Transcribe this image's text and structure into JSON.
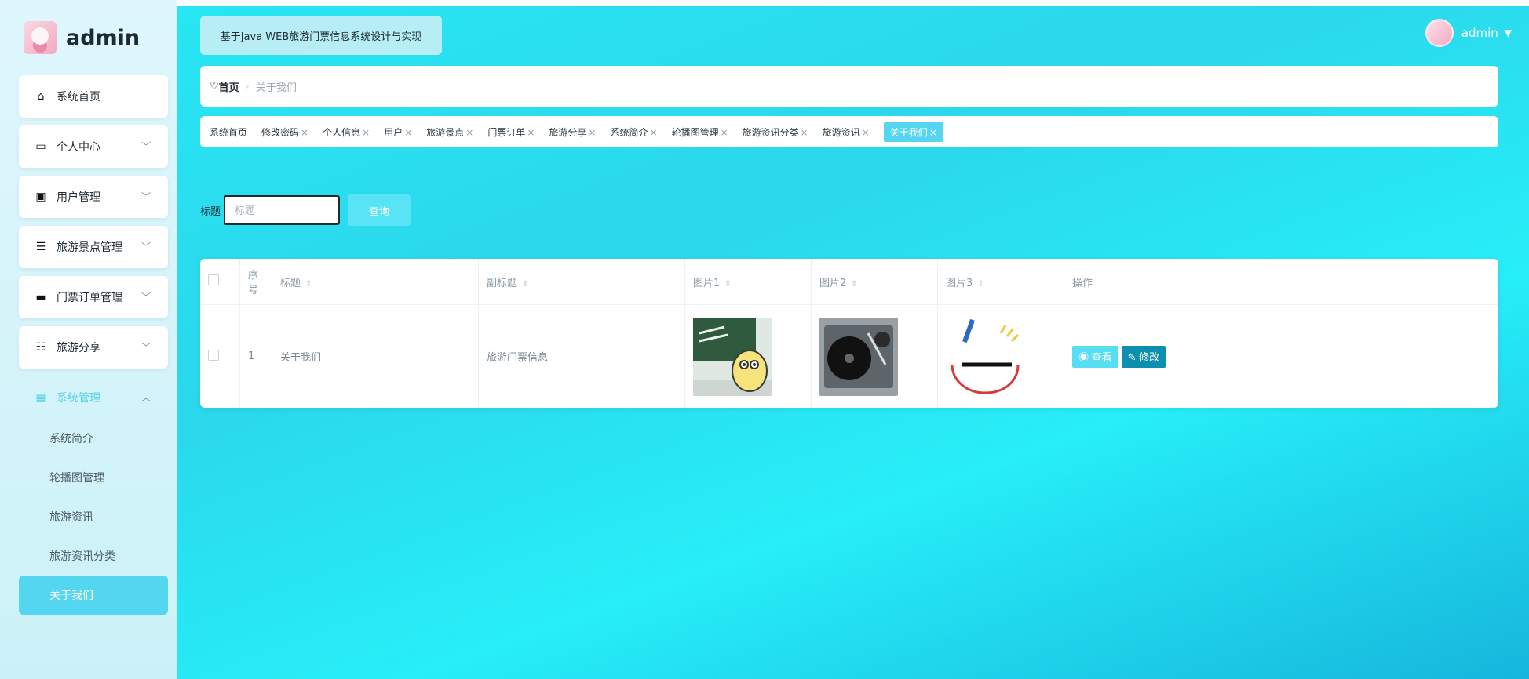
{
  "sidebar": {
    "brand": "admin",
    "items": [
      {
        "label": "系统首页",
        "icon": "home-icon",
        "chev": "",
        "active": false
      },
      {
        "label": "个人中心",
        "icon": "wallet-icon",
        "chev": "﹀",
        "active": false
      },
      {
        "label": "用户管理",
        "icon": "user-icon",
        "chev": "﹀",
        "active": false
      },
      {
        "label": "旅游景点管理",
        "icon": "list-icon",
        "chev": "﹀",
        "active": false
      },
      {
        "label": "门票订单管理",
        "icon": "chat-icon",
        "chev": "﹀",
        "active": false
      },
      {
        "label": "旅游分享",
        "icon": "sliders-icon",
        "chev": "﹀",
        "active": false
      },
      {
        "label": "系统管理",
        "icon": "grid-icon",
        "chev": "︿",
        "active": true
      }
    ],
    "subitems": [
      "系统简介",
      "轮播图管理",
      "旅游资讯",
      "旅游资讯分类",
      "关于我们"
    ]
  },
  "header": {
    "app_title": "基于Java WEB旅游门票信息系统设计与实现",
    "user": "admin"
  },
  "breadcrumb": {
    "home": "首页",
    "sep": "›",
    "current": "关于我们"
  },
  "tabs": [
    "系统首页",
    "修改密码",
    "个人信息",
    "用户",
    "旅游景点",
    "门票订单",
    "旅游分享",
    "系统简介",
    "轮播图管理",
    "旅游资讯分类",
    "旅游资讯",
    "关于我们"
  ],
  "search": {
    "label": "标题",
    "placeholder": "标题",
    "button": "查询"
  },
  "table": {
    "headers": [
      "序号",
      "标题",
      "副标题",
      "图片1",
      "图片2",
      "图片3",
      "操作"
    ],
    "rows": [
      {
        "index": "1",
        "title": "关于我们",
        "subtitle": "旅游门票信息",
        "view": "查看",
        "edit": "修改"
      }
    ]
  },
  "colors": {
    "accent": "#55d6f0",
    "main_bg": "#2bd7eb",
    "edit_btn": "#0d8fb0"
  }
}
